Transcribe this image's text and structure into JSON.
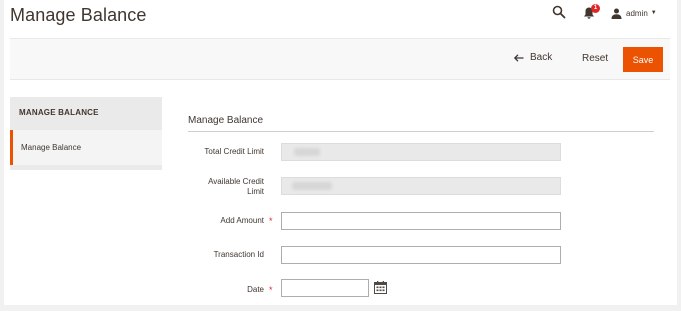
{
  "header": {
    "title": "Manage Balance",
    "notifications_count": "1",
    "user_name": "admin"
  },
  "toolbar": {
    "back_label": "Back",
    "reset_label": "Reset",
    "save_label": "Save"
  },
  "sidebar": {
    "title": "MANAGE BALANCE",
    "items": [
      {
        "label": "Manage Balance"
      }
    ]
  },
  "form": {
    "section_title": "Manage Balance",
    "fields": {
      "total_credit_limit": {
        "label": "Total Credit Limit",
        "value": ""
      },
      "available_credit_limit": {
        "label_line1": "Available Credit",
        "label_line2": "Limit",
        "value": ""
      },
      "add_amount": {
        "label": "Add Amount",
        "required": "*",
        "value": ""
      },
      "transaction_id": {
        "label": "Transaction Id",
        "value": ""
      },
      "date": {
        "label": "Date",
        "required": "*",
        "value": ""
      }
    }
  },
  "colors": {
    "accent": "#eb5202",
    "required": "#e22626",
    "text": "#41362f"
  }
}
